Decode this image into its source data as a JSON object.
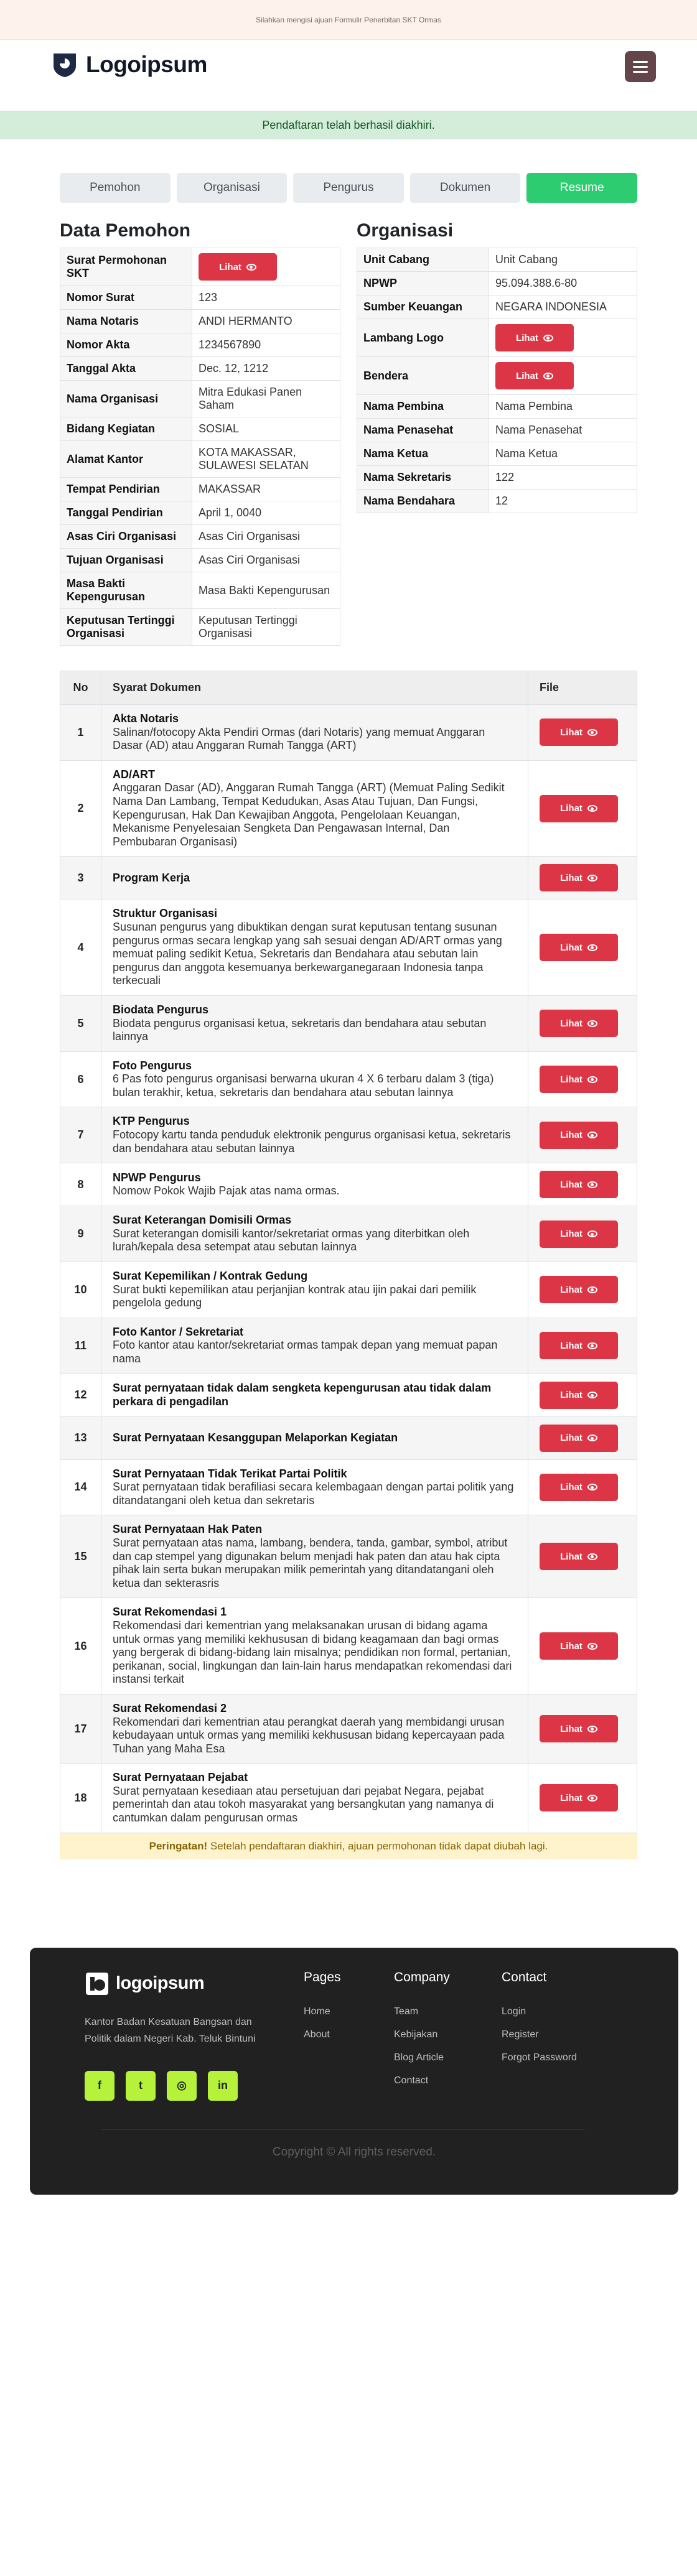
{
  "topbar": {
    "text": "Silahkan mengisi ajuan Formulir Penerbitan SKT Ormas"
  },
  "header": {
    "logo_text": "Logoipsum",
    "menu_icon": "hamburger-icon"
  },
  "alert": {
    "text": "Pendaftaran telah berhasil diakhiri."
  },
  "steps": [
    {
      "label": "Pemohon"
    },
    {
      "label": "Organisasi"
    },
    {
      "label": "Pengurus"
    },
    {
      "label": "Dokumen"
    },
    {
      "label": "Resume"
    }
  ],
  "view_label": "Lihat",
  "pemohon": {
    "title": "Data Pemohon",
    "rows": [
      {
        "key": "Surat Permohonan SKT",
        "value": ""
      },
      {
        "key": "Nomor Surat",
        "value": "123"
      },
      {
        "key": "Nama Notaris",
        "value": "ANDI HERMANTO"
      },
      {
        "key": "Nomor Akta",
        "value": "1234567890"
      },
      {
        "key": "Tanggal Akta",
        "value": "Dec. 12, 1212"
      },
      {
        "key": "Nama Organisasi",
        "value": "Mitra Edukasi Panen Saham"
      },
      {
        "key": "Bidang Kegiatan",
        "value": "SOSIAL"
      },
      {
        "key": "Alamat Kantor",
        "value": "KOTA MAKASSAR, SULAWESI SELATAN"
      },
      {
        "key": "Tempat Pendirian",
        "value": "MAKASSAR"
      },
      {
        "key": "Tanggal Pendirian",
        "value": "April 1, 0040"
      },
      {
        "key": "Asas Ciri Organisasi",
        "value": "Asas Ciri Organisasi"
      },
      {
        "key": "Tujuan Organisasi",
        "value": "Asas Ciri Organisasi"
      },
      {
        "key": "Masa Bakti Kepengurusan",
        "value": "Masa Bakti Kepengurusan"
      },
      {
        "key": "Keputusan Tertinggi Organisasi",
        "value": "Keputusan Tertinggi Organisasi"
      }
    ]
  },
  "organisasi": {
    "title": "Organisasi",
    "rows": [
      {
        "key": "Unit Cabang",
        "value": "Unit Cabang"
      },
      {
        "key": "NPWP",
        "value": "95.094.388.6-80"
      },
      {
        "key": "Sumber Keuangan",
        "value": "NEGARA INDONESIA"
      },
      {
        "key": "Lambang Logo",
        "value": ""
      },
      {
        "key": "Bendera",
        "value": ""
      },
      {
        "key": "Nama Pembina",
        "value": "Nama Pembina"
      },
      {
        "key": "Nama Penasehat",
        "value": "Nama Penasehat"
      },
      {
        "key": "Nama Ketua",
        "value": "Nama Ketua"
      },
      {
        "key": "Nama Sekretaris",
        "value": "122"
      },
      {
        "key": "Nama Bendahara",
        "value": "12"
      }
    ]
  },
  "documents": {
    "headers": {
      "no": "No",
      "doc": "Syarat Dokumen",
      "file": "File"
    },
    "rows": [
      {
        "no": "1",
        "title": "Akta Notaris",
        "desc": "Salinan/fotocopy Akta Pendiri Ormas (dari Notaris) yang memuat Anggaran Dasar (AD) atau Anggaran Rumah Tangga (ART)"
      },
      {
        "no": "2",
        "title": "AD/ART",
        "desc": "Anggaran Dasar (AD), Anggaran Rumah Tangga (ART) (Memuat Paling Sedikit Nama Dan Lambang, Tempat Kedudukan, Asas Atau Tujuan, Dan Fungsi, Kepengurusan, Hak Dan Kewajiban Anggota, Pengelolaan Keuangan, Mekanisme Penyelesaian Sengketa Dan Pengawasan Internal, Dan Pembubaran Organisasi)"
      },
      {
        "no": "3",
        "title": "Program Kerja",
        "desc": ""
      },
      {
        "no": "4",
        "title": "Struktur Organisasi",
        "desc": "Susunan pengurus yang dibuktikan dengan surat keputusan tentang susunan pengurus ormas secara lengkap yang sah sesuai dengan AD/ART ormas yang memuat paling sedikit Ketua, Sekretaris dan Bendahara atau sebutan lain pengurus dan anggota kesemuanya berkewarganegaraan Indonesia tanpa terkecuali"
      },
      {
        "no": "5",
        "title": "Biodata Pengurus",
        "desc": "Biodata pengurus organisasi ketua, sekretaris dan bendahara atau sebutan lainnya"
      },
      {
        "no": "6",
        "title": "Foto Pengurus",
        "desc": "6 Pas foto pengurus organisasi berwarna ukuran 4 X 6 terbaru dalam 3 (tiga) bulan terakhir, ketua, sekretaris dan bendahara atau sebutan lainnya"
      },
      {
        "no": "7",
        "title": "KTP Pengurus",
        "desc": "Fotocopy kartu tanda penduduk elektronik pengurus organisasi ketua, sekretaris dan bendahara atau sebutan lainnya"
      },
      {
        "no": "8",
        "title": "NPWP Pengurus",
        "desc": "Nomow Pokok Wajib Pajak atas nama ormas."
      },
      {
        "no": "9",
        "title": "Surat Keterangan Domisili Ormas",
        "desc": "Surat keterangan domisili kantor/sekretariat ormas yang diterbitkan oleh lurah/kepala desa setempat atau sebutan lainnya"
      },
      {
        "no": "10",
        "title": "Surat Kepemilikan / Kontrak Gedung",
        "desc": "Surat bukti kepemilikan atau perjanjian kontrak atau ijin pakai dari pemilik pengelola gedung"
      },
      {
        "no": "11",
        "title": "Foto Kantor / Sekretariat",
        "desc": "Foto kantor atau kantor/sekretariat ormas tampak depan yang memuat papan nama"
      },
      {
        "no": "12",
        "title": "Surat pernyataan tidak dalam sengketa kepengurusan atau tidak dalam perkara di pengadilan",
        "desc": ""
      },
      {
        "no": "13",
        "title": "Surat Pernyataan Kesanggupan Melaporkan Kegiatan",
        "desc": ""
      },
      {
        "no": "14",
        "title": "Surat Pernyataan Tidak Terikat Partai Politik",
        "desc": "Surat pernyataan tidak berafiliasi secara kelembagaan dengan partai politik yang ditandatangani oleh ketua dan sekretaris"
      },
      {
        "no": "15",
        "title": "Surat Pernyataan Hak Paten",
        "desc": "Surat pernyataan atas nama, lambang, bendera, tanda, gambar, symbol, atribut dan cap stempel yang digunakan belum menjadi hak paten dan atau hak cipta pihak lain serta bukan merupakan milik pemerintah yang ditandatangani oleh ketua dan sekterasris"
      },
      {
        "no": "16",
        "title": "Surat Rekomendasi 1",
        "desc": "Rekomendasi dari kementrian yang melaksanakan urusan di bidang agama untuk ormas yang memiliki kekhususan di bidang keagamaan dan bagi ormas yang bergerak di bidang-bidang lain misalnya; pendidikan non formal, pertanian, perikanan, social, lingkungan dan lain-lain harus mendapatkan rekomendasi dari instansi terkait"
      },
      {
        "no": "17",
        "title": "Surat Rekomendasi 2",
        "desc": "Rekomendari dari kementrian atau perangkat daerah yang membidangi urusan kebudayaan untuk ormas yang memiliki kekhususan bidang kepercayaan pada Tuhan yang Maha Esa"
      },
      {
        "no": "18",
        "title": "Surat Pernyataan Pejabat",
        "desc": "Surat pernyataan kesediaan atau persetujuan dari pejabat Negara, pejabat pemerintah dan atau tokoh masyarakat yang bersangkutan yang namanya di cantumkan dalam pengurusan ormas"
      }
    ]
  },
  "warning": {
    "strong": "Peringatan!",
    "text": " Setelah pendaftaran diakhiri, ajuan permohonan tidak dapat diubah lagi."
  },
  "footer": {
    "logo_text": "logoipsum",
    "description": "Kantor Badan Kesatuan Bangsan dan Politik dalam Negeri Kab. Teluk Bintuni",
    "social": [
      {
        "icon": "facebook-icon",
        "glyph": "f"
      },
      {
        "icon": "twitter-icon",
        "glyph": "t"
      },
      {
        "icon": "instagram-icon",
        "glyph": "◎"
      },
      {
        "icon": "linkedin-icon",
        "glyph": "in"
      }
    ],
    "columns": [
      {
        "title": "Pages",
        "links": [
          "Home",
          "About"
        ]
      },
      {
        "title": "Company",
        "links": [
          "Team",
          "Kebijakan",
          "Blog Article",
          "Contact"
        ]
      },
      {
        "title": "Contact",
        "links": [
          "Login",
          "Register",
          "Forgot Password"
        ]
      }
    ],
    "copyright": "Copyright © All rights reserved."
  }
}
